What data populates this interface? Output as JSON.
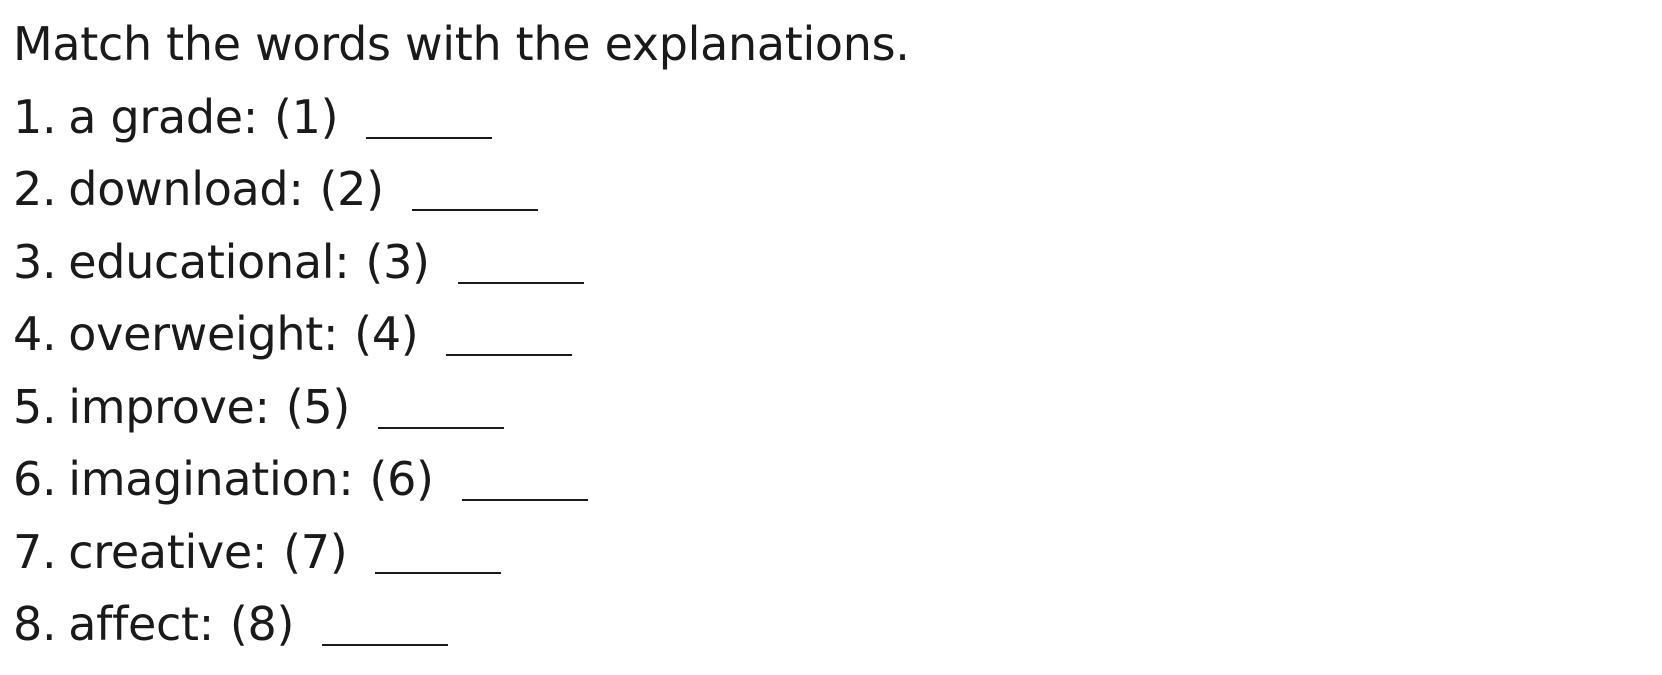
{
  "instruction": "Match the words with the explanations.",
  "items": [
    {
      "number": "1.",
      "word": "a grade:",
      "blank_label": "(1)",
      "answer": "______"
    },
    {
      "number": "2.",
      "word": "download:",
      "blank_label": "(2)",
      "answer": "______"
    },
    {
      "number": "3.",
      "word": "educational:",
      "blank_label": "(3)",
      "answer": "______"
    },
    {
      "number": "4.",
      "word": "overweight:",
      "blank_label": "(4)",
      "answer": "______"
    },
    {
      "number": "5.",
      "word": "improve:",
      "blank_label": "(5)",
      "answer": "______"
    },
    {
      "number": "6.",
      "word": "imagination:",
      "blank_label": "(6)",
      "answer": "______"
    },
    {
      "number": "7.",
      "word": "creative:",
      "blank_label": "(7)",
      "answer": "______"
    },
    {
      "number": "8.",
      "word": "affect:",
      "blank_label": "(8)",
      "answer": "______"
    }
  ]
}
